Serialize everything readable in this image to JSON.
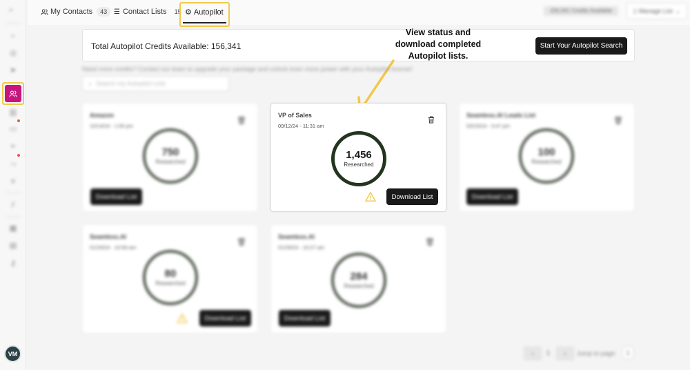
{
  "sidebar": {
    "avatar_initials": "VM",
    "active_color": "#c8157e"
  },
  "tabs": {
    "my_contacts": {
      "label": "My Contacts",
      "count": "43"
    },
    "contact_lists": {
      "label": "Contact Lists",
      "count": "15"
    },
    "autopilot": {
      "label": "Autopilot"
    }
  },
  "header": {
    "credits_pill": "156,341 Credits Available",
    "manage_list": "Manage List"
  },
  "banner": {
    "credits_text": "Total Autopilot Credits Available: 156,341",
    "start_button": "Start Your Autopilot Search"
  },
  "annotation": {
    "line1": "View status and",
    "line2": "download completed",
    "line3": "Autopilot lists."
  },
  "help_text": "Need more credits? Contact our team to upgrade your package and unlock even more power with your Autopilot license!",
  "search": {
    "placeholder": "Search my Autopilot Lists"
  },
  "cards": [
    {
      "name": "Amazon",
      "date": "10/14/24 - 1:00 pm",
      "count": "750",
      "count_label": "Researched",
      "download": "Download List"
    },
    {
      "name": "VP of Sales",
      "date": "09/12/24 - 11:31 am",
      "count": "1,456",
      "count_label": "Researched",
      "download": "Download List"
    },
    {
      "name": "Seamless.AI Leads List",
      "date": "03/15/24 - 3:47 pm",
      "count": "100",
      "count_label": "Researched",
      "download": "Download List"
    },
    {
      "name": "Seamless.AI",
      "date": "01/29/24 - 10:59 am",
      "count": "80",
      "count_label": "Researched",
      "download": "Download List"
    },
    {
      "name": "Seamless.AI",
      "date": "01/29/24 - 10:27 am",
      "count": "284",
      "count_label": "Researched",
      "download": "Download List"
    }
  ],
  "pagination": {
    "prev": "‹",
    "page": "1",
    "next": "›",
    "jump_label": "Jump to page:",
    "jump_value": "1"
  },
  "colors": {
    "highlight": "#f2c84b",
    "ring_focus": "#24341f",
    "button_dark": "#1a1a1a"
  }
}
